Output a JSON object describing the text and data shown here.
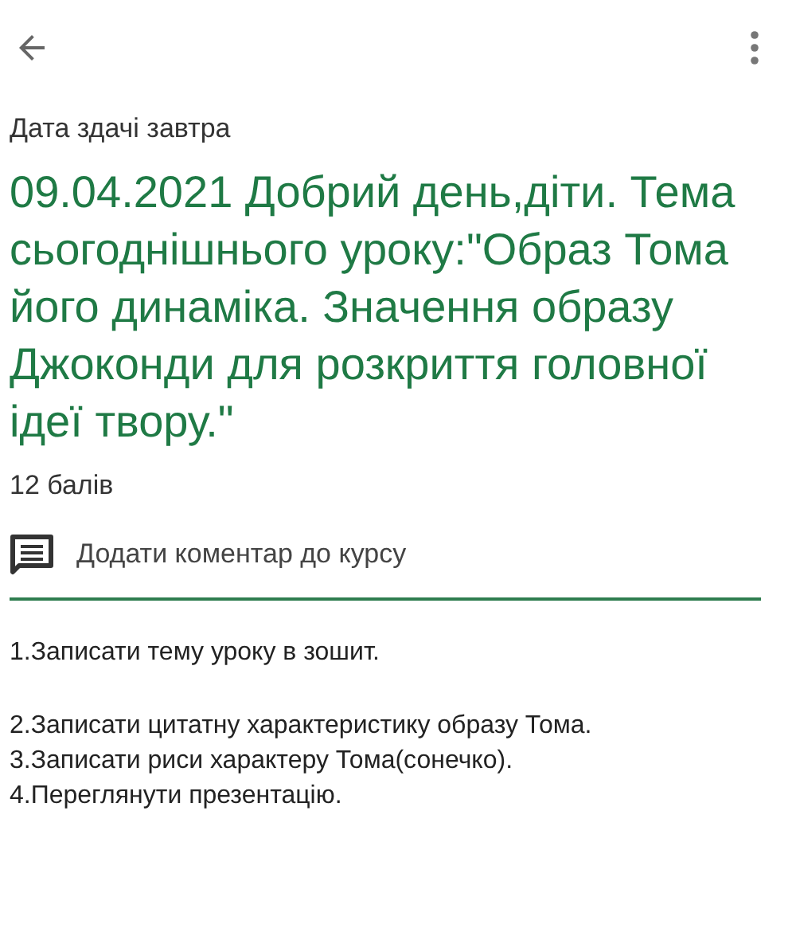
{
  "due": "Дата здачі завтра",
  "title": "09.04.2021 Добрий день,діти. Тема сьогоднішнього уроку:\"Образ Тома його динаміка. Значення образу Джоконди для розкриття головної ідеї твору.\"",
  "points": "12 балів",
  "comment_link": "Додати коментар до курсу",
  "instructions": [
    {
      "lines": [
        "1.Записати тему уроку в зошит."
      ]
    },
    {
      "lines": [
        "2.Записати цитатну характеристику образу Тома.",
        "3.Записати риси характеру Тома(сонечко).",
        "4.Переглянути презентацію."
      ]
    }
  ]
}
